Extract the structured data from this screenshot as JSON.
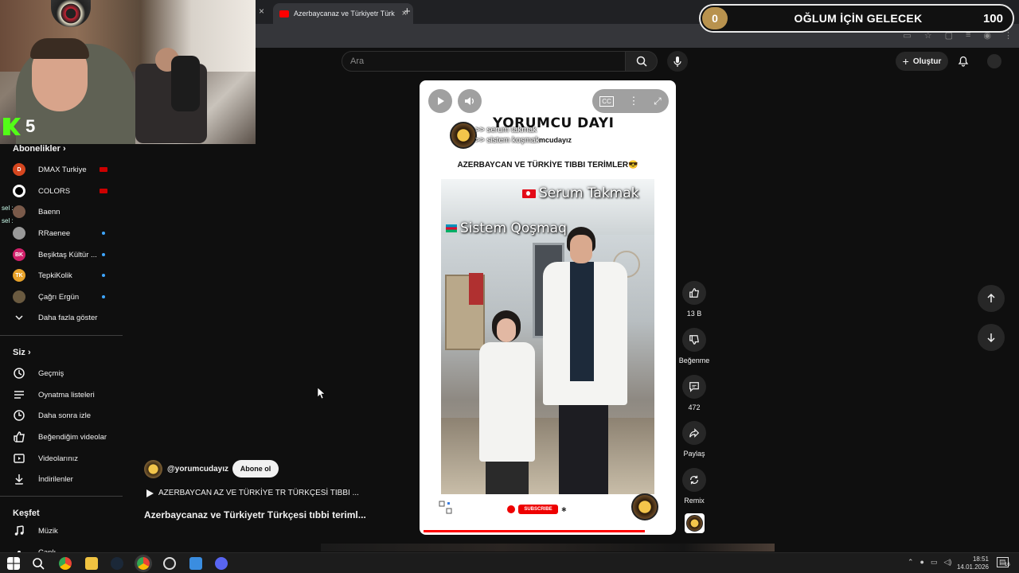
{
  "webcam": {
    "kick_count": "5"
  },
  "browser": {
    "tab_title": "Azerbaycanaz ve Türkiyetr Türk",
    "close_prev": "×",
    "tab_close": "×",
    "new_tab": "+"
  },
  "goal": {
    "current": "0",
    "title": "OĞLUM İÇİN GELECEK",
    "target": "100"
  },
  "header": {
    "search_placeholder": "Ara",
    "create_label": "Oluştur"
  },
  "sidebar": {
    "subscriptions_title": "Abonelikler",
    "subscriptions": [
      {
        "label": "DMAX Turkiye",
        "icon": "dmax",
        "status": "live"
      },
      {
        "label": "COLORS",
        "icon": "colors",
        "status": "live"
      },
      {
        "label": "Baenn",
        "icon": "baenn",
        "status": "none"
      },
      {
        "label": "RRaenee",
        "icon": "rraenee",
        "status": "dot"
      },
      {
        "label": "Beşiktaş Kültür ...",
        "icon": "besiktas",
        "status": "dot"
      },
      {
        "label": "TepkiKolik",
        "icon": "tepkikolik",
        "status": "dot"
      },
      {
        "label": "Çağrı Ergün",
        "icon": "cagri",
        "status": "dot"
      }
    ],
    "show_more": "Daha fazla göster",
    "you_title": "Siz",
    "you_items": [
      "Geçmiş",
      "Oynatma listeleri",
      "Daha sonra izle",
      "Beğendiğim videolar",
      "Videolarınız",
      "İndirilenler"
    ],
    "explore_title": "Keşfet",
    "explore_items": [
      "Müzik",
      "Canlı"
    ],
    "chat_overlay": [
      "sel : ",
      "sel : "
    ]
  },
  "short": {
    "brand": "YORUMCU DAYI",
    "brand_sub": "mcudayız",
    "overlay_lines": [
      ">> serum takmak",
      ">> sistem koşmak"
    ],
    "heading": "AZERBAYCAN VE TÜRKİYE TIBBI TERİMLER😎",
    "caption_tr": "Serum Takmak",
    "caption_az": "Sistem Qoşmaq",
    "subscribe_badge": "SUBSCRIBE",
    "progress": 0.89
  },
  "actions": {
    "like_count": "13 B",
    "dislike_label": "Beğenme",
    "comment_count": "472",
    "share_label": "Paylaş",
    "remix_label": "Remix"
  },
  "channel": {
    "handle": "@yorumcudayız",
    "subscribe_label": "Abone ol",
    "mini_title": "AZERBAYCAN AZ VE TÜRKİYE TR TÜRKÇESİ TIBBI ...",
    "title": "Azerbaycanaz ve Türkiyetr Türkçesi tıbbi teriml..."
  },
  "taskbar": {
    "time": "18:51",
    "date": "14.01.2026",
    "badge": "16"
  }
}
